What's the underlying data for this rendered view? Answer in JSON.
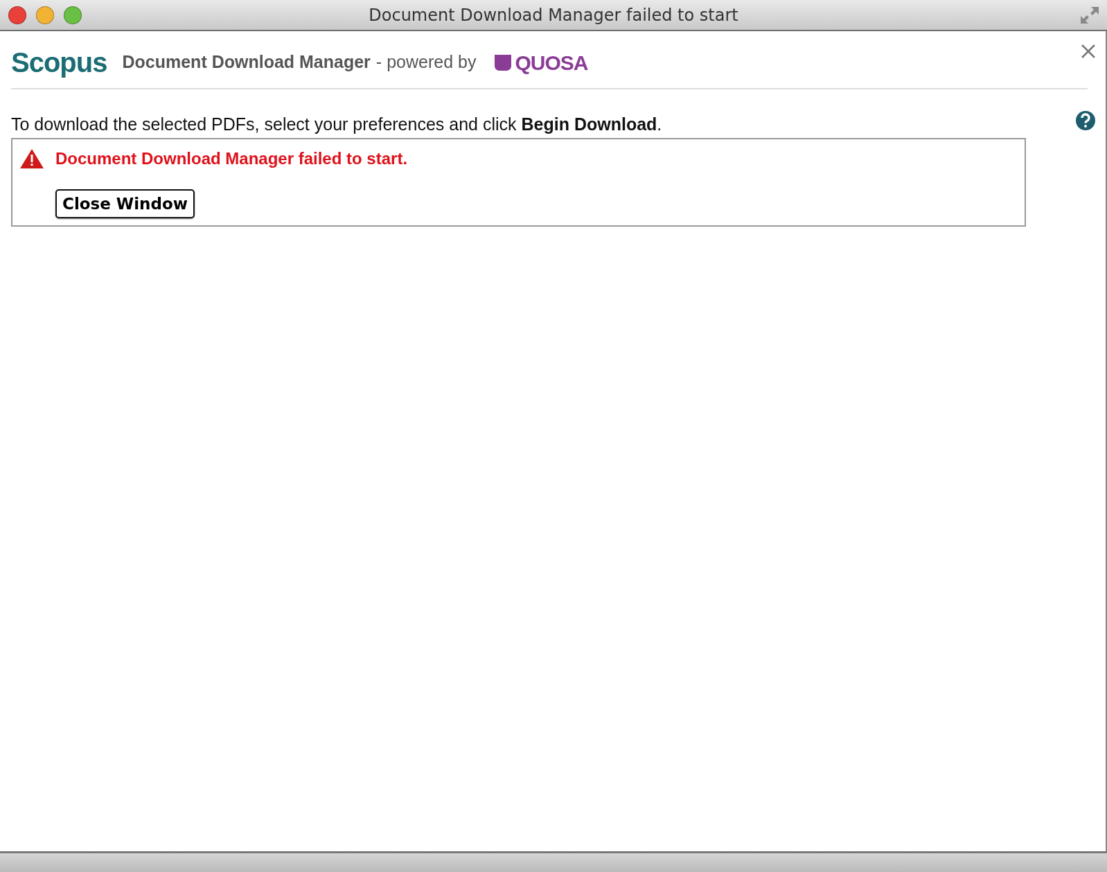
{
  "window": {
    "title": "Document Download Manager failed to start"
  },
  "header": {
    "logo": "Scopus",
    "title": "Document Download Manager",
    "powered_by": "- powered by",
    "partner_logo": "QUOSA"
  },
  "instruction": "To download the selected PDFs, select your preferences and click **Begin Download**.",
  "error": {
    "message": "Document Download Manager failed to start."
  },
  "buttons": [
    "Close Window"
  ]
}
